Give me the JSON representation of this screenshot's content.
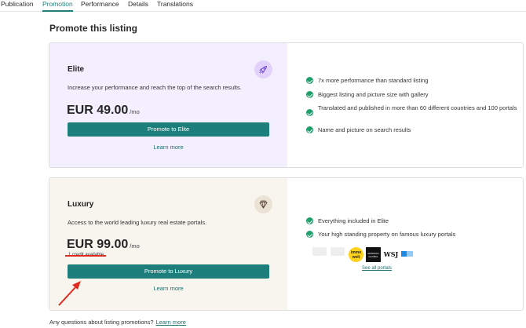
{
  "tabs": [
    {
      "label": "Publication",
      "active": false
    },
    {
      "label": "Promotion",
      "active": true
    },
    {
      "label": "Performance",
      "active": false
    },
    {
      "label": "Details",
      "active": false
    },
    {
      "label": "Translations",
      "active": false
    }
  ],
  "page_title": "Promote this listing",
  "elite": {
    "name": "Elite",
    "description": "Increase your performance and reach the top of the search results.",
    "price": "EUR 49.00",
    "per": "/mo",
    "button": "Promote to Elite",
    "learn_more": "Learn more",
    "icon": "rocket-icon",
    "bg_color": "#f4efff",
    "features": [
      "7x more performance than standard listing",
      "Biggest listing and picture size with gallery",
      "Translated and published in more than 60 different countries and 100 portals",
      "Name and picture on search results"
    ]
  },
  "luxury": {
    "name": "Luxury",
    "description": "Access to the world leading luxury real estate portals.",
    "price": "EUR 99.00",
    "per": "/mo",
    "credit": "1 credit available",
    "button": "Promote to Luxury",
    "learn_more": "Learn more",
    "icon": "diamond-icon",
    "bg_color": "#f8f5ef",
    "features": [
      "Everything included in Elite",
      "Your high standing property on famous luxury portals"
    ],
    "portals": [
      "immo welt",
      "MANSION GLOBAL",
      "WSJ"
    ],
    "see_all": "See all portals"
  },
  "footer": {
    "question": "Any questions about listing promotions?",
    "link": "Learn more"
  },
  "colors": {
    "accent": "#1d7f7c",
    "check": "#1fa06a",
    "annotation": "#e02b20"
  }
}
